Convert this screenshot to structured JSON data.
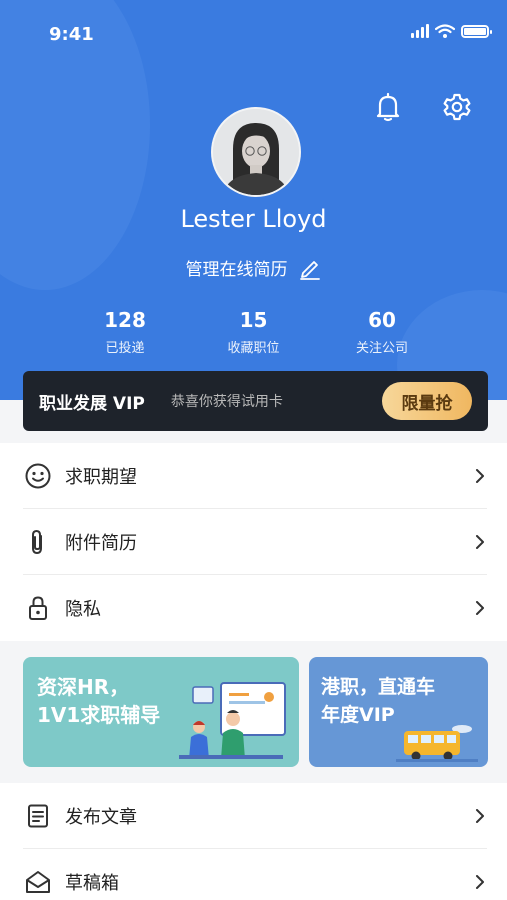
{
  "status": {
    "time": "9:41"
  },
  "profile": {
    "name": "Lester Lloyd",
    "manage_resume": "管理在线简历"
  },
  "stats": [
    {
      "value": "128",
      "label": "已投递"
    },
    {
      "value": "15",
      "label": "收藏职位"
    },
    {
      "value": "60",
      "label": "关注公司"
    }
  ],
  "vip": {
    "title": "职业发展 VIP",
    "subtitle": "恭喜你获得试用卡",
    "button": "限量抢"
  },
  "menu_top": [
    {
      "label": "求职期望",
      "icon": "smile-icon"
    },
    {
      "label": "附件简历",
      "icon": "paperclip-icon"
    },
    {
      "label": "隐私",
      "icon": "lock-icon"
    }
  ],
  "banners": {
    "left": {
      "line1": "资深HR，",
      "line2": "1V1求职辅导"
    },
    "right": {
      "line1": "港职，直通车",
      "line2": "年度VIP"
    }
  },
  "menu_bottom": [
    {
      "label": "发布文章",
      "icon": "document-icon"
    },
    {
      "label": "草稿箱",
      "icon": "envelope-open-icon"
    }
  ],
  "colors": {
    "header_blue": "#3a7be0",
    "vip_dark": "#1e232b",
    "vip_gold": "#f0b760",
    "banner_teal": "#7ec9c8",
    "banner_blue": "#6697d6"
  }
}
